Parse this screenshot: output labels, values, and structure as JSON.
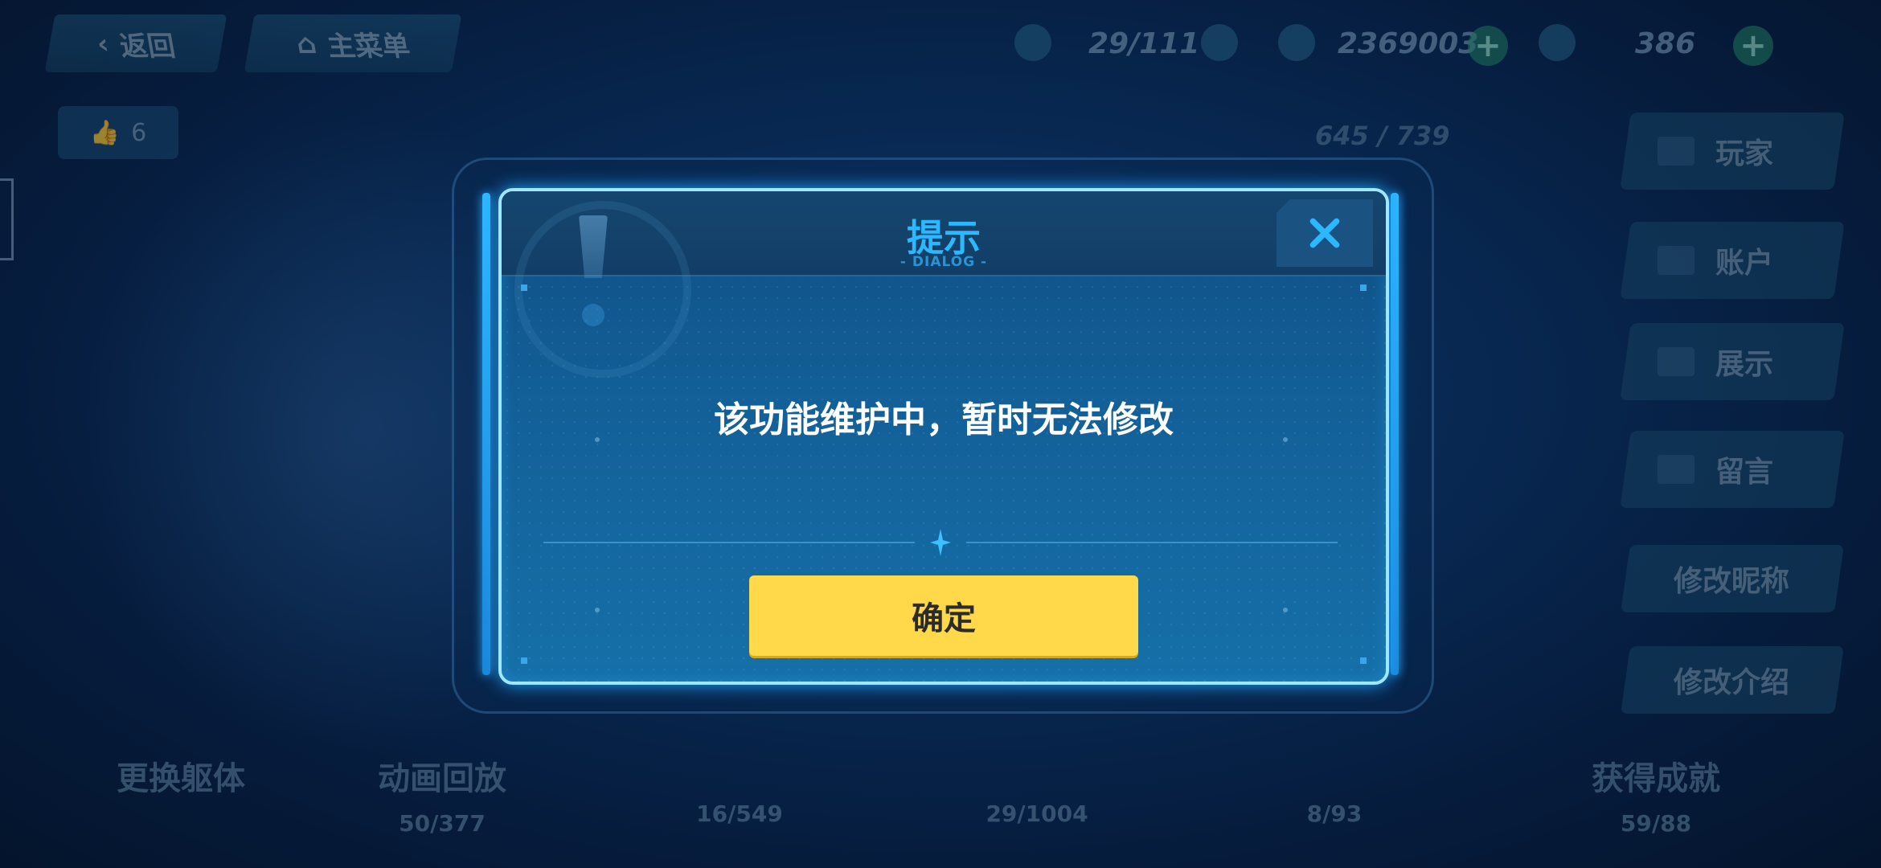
{
  "topbar": {
    "back_label": "返回",
    "menu_label": "主菜单",
    "resource_1": "29/111",
    "resource_2": "2369003",
    "resource_3": "386"
  },
  "profile": {
    "likes": "6",
    "score": "645 / 739"
  },
  "side_menu": {
    "items": [
      {
        "label": "玩家"
      },
      {
        "label": "账户"
      },
      {
        "label": "展示"
      },
      {
        "label": "留言"
      }
    ],
    "edit_nickname": "修改昵称",
    "edit_intro": "修改介绍"
  },
  "bottom_stats": [
    {
      "label": "更换躯体",
      "value": ""
    },
    {
      "label": "动画回放",
      "value": "50/377"
    },
    {
      "label": "",
      "value": "16/549"
    },
    {
      "label": "",
      "value": "29/1004"
    },
    {
      "label": "",
      "value": "8/93"
    },
    {
      "label": "获得成就",
      "value": "59/88"
    }
  ],
  "dialog": {
    "title": "提示",
    "subtitle": "- DIALOG -",
    "message": "该功能维护中，暂时无法修改",
    "confirm_label": "确定",
    "close_icon": "close-icon"
  },
  "colors": {
    "accent": "#2bb8ff",
    "confirm": "#ffd94a",
    "frame": "#9fe7ff"
  }
}
